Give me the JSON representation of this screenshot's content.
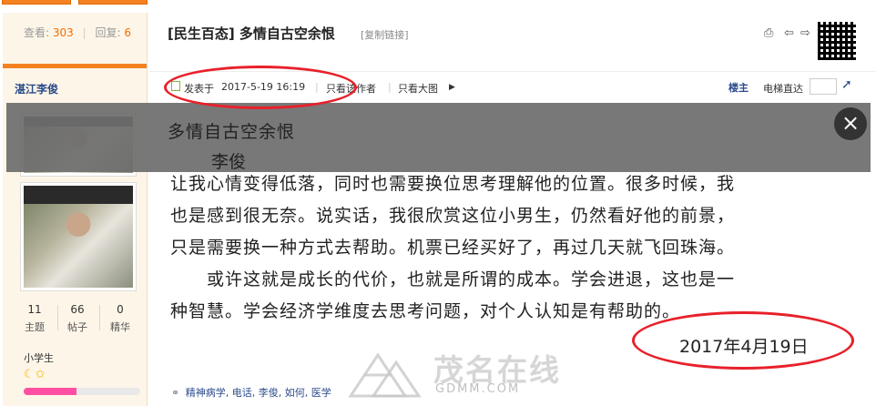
{
  "top_tabs": [
    {
      "label": ""
    },
    {
      "label": ""
    }
  ],
  "sidebar": {
    "views_label": "查看:",
    "views": "303",
    "replies_label": "回复:",
    "replies": "6",
    "username": "湛江李俊",
    "stats": [
      {
        "value": "11",
        "label": "主题"
      },
      {
        "value": "66",
        "label": "帖子"
      },
      {
        "value": "0",
        "label": "精华"
      }
    ],
    "rank": "小学生",
    "stars_icon": "☾✩",
    "level_progress": 0.45
  },
  "post": {
    "title": "[民生百态] 多情自古空余恨",
    "copy_link": "[复制链接]",
    "meta": {
      "posted_label": "发表于",
      "posted_at": "2017-5-19 16:19",
      "only_author": "只看该作者",
      "only_big_images": "只看大图",
      "floor": "楼主",
      "elevator": "电梯直达"
    },
    "content_lines": [
      "让我心情变得低落，同时也需要换位思考理解他的位置。很多时候，我",
      "也是感到很无奈。说实话，我很欣赏这位小男生，仍然看好他的前景，",
      "只是需要换一种方式去帮助。机票已经买好了，再过几天就飞回珠海。",
      "　　或许这就是成长的代价，也就是所谓的成本。学会进退，这也是一",
      "种智慧。学会经济学维度去思考问题，对个人认知是有帮助的。"
    ],
    "date": "2017年4月19日",
    "tags": [
      "精神病学",
      "电话",
      "李俊",
      "如何",
      "医学"
    ]
  },
  "overlay": {
    "title": "多情自古空余恨",
    "author": "李俊",
    "close": "×"
  },
  "watermark": {
    "text": "茂名在线",
    "sub": "GDMM.COM"
  },
  "colors": {
    "accent": "#f58220",
    "link": "#2b4a8b",
    "annotation": "#e8202a"
  }
}
